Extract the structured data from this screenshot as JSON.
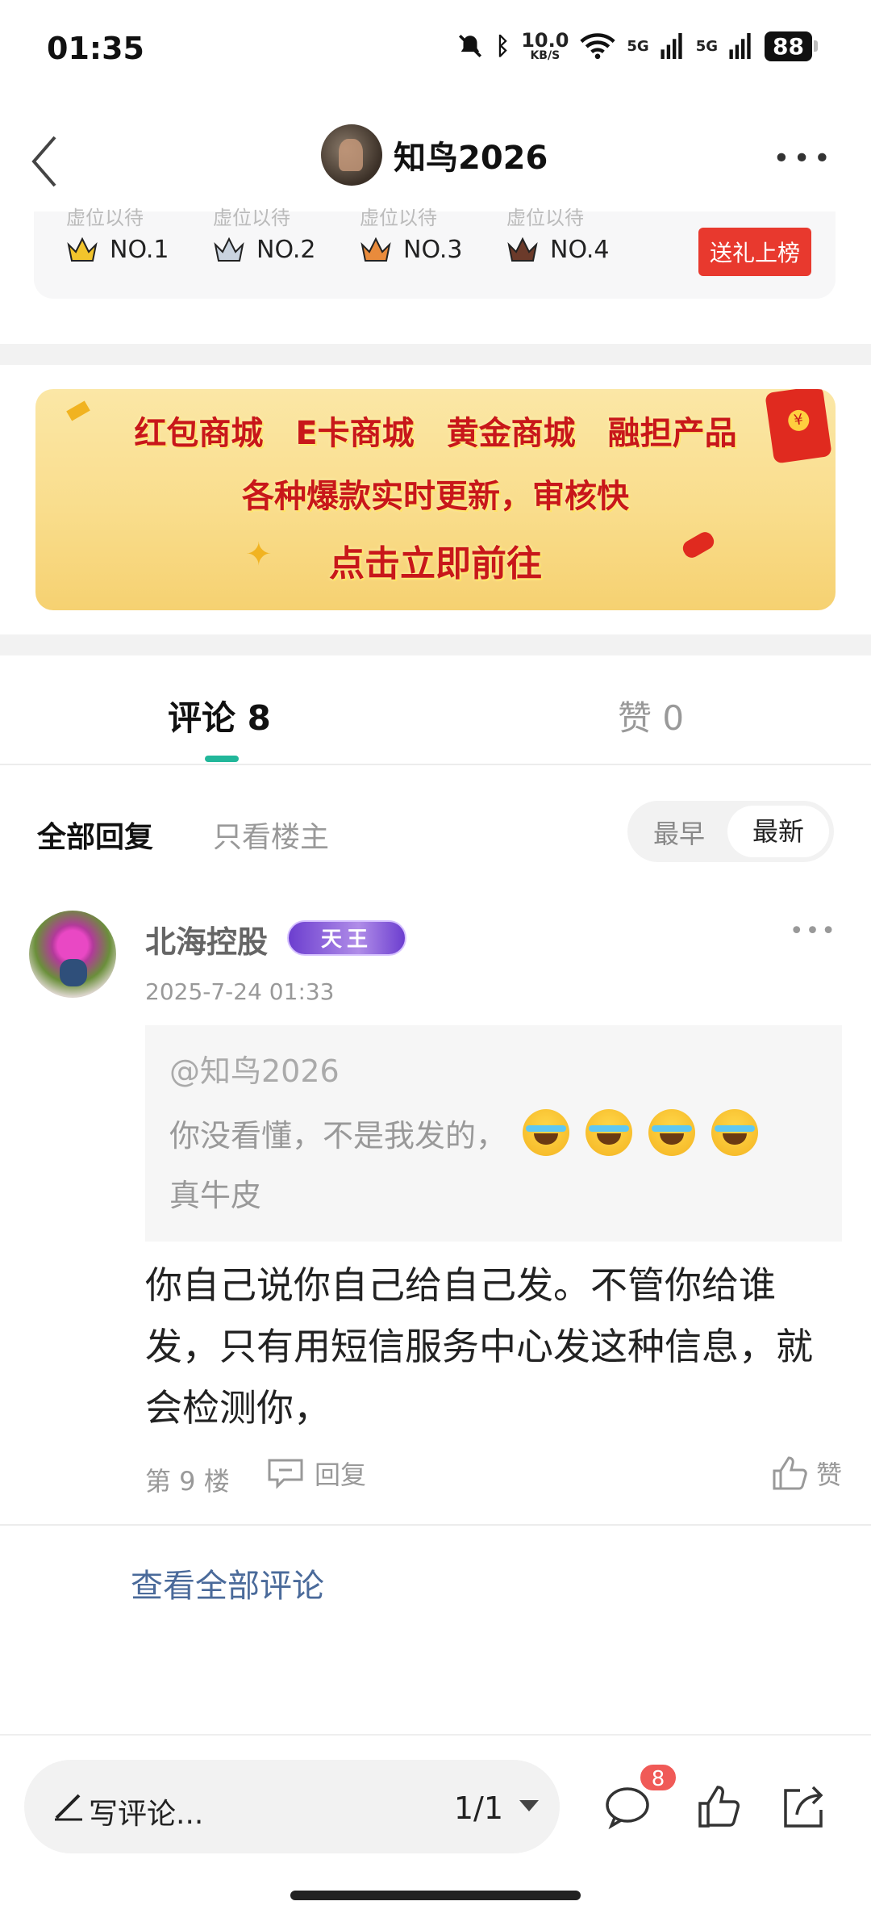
{
  "status_bar": {
    "time": "01:35",
    "net_speed_value": "10.0",
    "net_speed_unit": "KB/S",
    "signal1": "5G",
    "signal2": "5G",
    "battery": "88"
  },
  "header": {
    "title": "知鸟2026"
  },
  "ranking": {
    "ghost_text": "虚位以待",
    "items": [
      {
        "label": "NO.1",
        "color": "#f2c42c"
      },
      {
        "label": "NO.2",
        "color": "#c9d3df"
      },
      {
        "label": "NO.3",
        "color": "#e98b3c"
      },
      {
        "label": "NO.4",
        "color": "#6b3a2a"
      }
    ],
    "gift_button": "送礼上榜"
  },
  "banner": {
    "row1": [
      "红包商城",
      "E卡商城",
      "黄金商城",
      "融担产品"
    ],
    "row2": "各种爆款实时更新，审核快",
    "row3": "点击立即前往"
  },
  "tabs": {
    "comments": "评论 8",
    "likes": "赞 0",
    "accent": "#22b79a"
  },
  "filter": {
    "all": "全部回复",
    "op_only": "只看楼主",
    "sort_early": "最早",
    "sort_new": "最新"
  },
  "comment": {
    "author": "北海控股",
    "badge": "天王",
    "time": "2025-7-24 01:33",
    "quote_at": "@知鸟2026",
    "quote_line1": "你没看懂，不是我发的，",
    "quote_line2": "真牛皮",
    "body": "你自己说你自己给自己发。不管你给谁发，只有用短信服务中心发这种信息，就会检测你，",
    "floor": "第 9 楼",
    "reply": "回复",
    "like": "赞"
  },
  "view_all": "查看全部评论",
  "bottom": {
    "write_placeholder": "写评论...",
    "pager": "1/1",
    "comment_count": "8"
  }
}
